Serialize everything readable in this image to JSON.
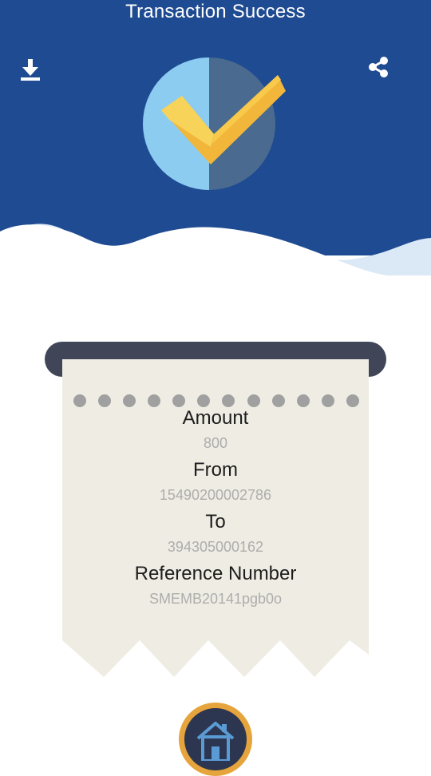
{
  "header": {
    "title": "Transaction Success",
    "background_color": "#1f4b92",
    "download_icon": "download-icon",
    "share_icon": "share-icon",
    "status_icon": "check-badge-icon"
  },
  "receipt": {
    "fields": [
      {
        "label": "Amount",
        "value": "800"
      },
      {
        "label": "From",
        "value": "15490200002786"
      },
      {
        "label": "To",
        "value": "394305000162"
      },
      {
        "label": "Reference Number",
        "value": "SMEMB20141pgb0o"
      }
    ],
    "paper_color": "#efece3",
    "slot_color": "#414558"
  },
  "footer": {
    "home_icon": "home-icon",
    "accent_color": "#e6a43c"
  }
}
